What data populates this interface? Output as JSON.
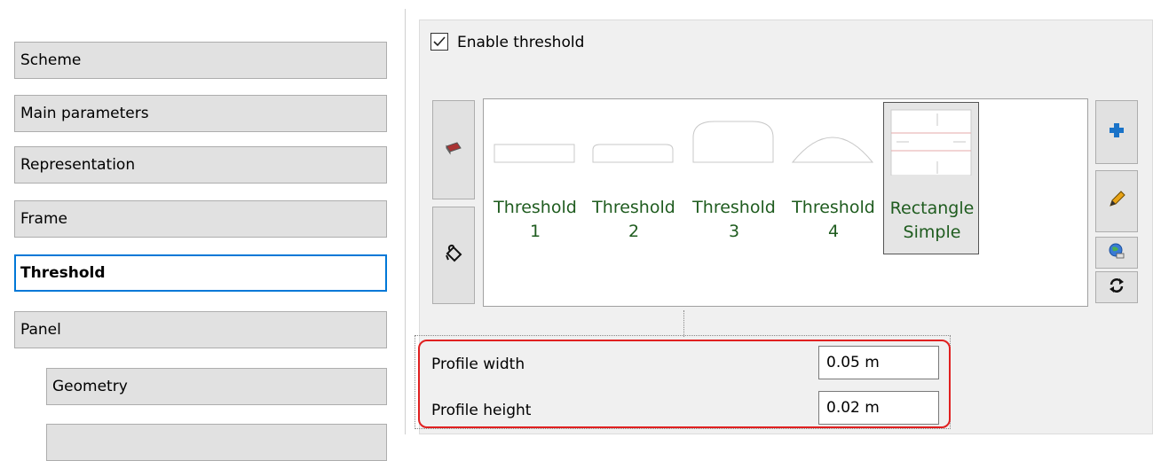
{
  "nav": {
    "items": [
      {
        "label": "Scheme"
      },
      {
        "label": "Main parameters"
      },
      {
        "label": "Representation"
      },
      {
        "label": "Frame"
      },
      {
        "label": "Threshold",
        "active": true
      },
      {
        "label": "Panel"
      },
      {
        "label": "Geometry"
      },
      {
        "label": ""
      }
    ]
  },
  "threshold": {
    "enable_label": "Enable threshold",
    "enabled": true
  },
  "gallery": {
    "items": [
      {
        "label": "Threshold 1",
        "icon": "flat-rectangle-threshold"
      },
      {
        "label": "Threshold 2",
        "icon": "rounded-threshold"
      },
      {
        "label": "Threshold 3",
        "icon": "high-rounded-threshold"
      },
      {
        "label": "Threshold 4",
        "icon": "arc-threshold"
      },
      {
        "label": "Rectangle Simple",
        "icon": "rectangle-simple-threshold",
        "selected": true
      }
    ]
  },
  "left_tools": [
    {
      "icon": "eraser-icon"
    },
    {
      "icon": "paint-bucket-icon"
    }
  ],
  "right_tools": [
    {
      "icon": "add-icon",
      "color": "#1a73c8"
    },
    {
      "icon": "pencil-icon",
      "color": "#e8a317"
    },
    {
      "icon": "globe-icon"
    },
    {
      "icon": "refresh-icon"
    }
  ],
  "profile": {
    "width_label": "Profile width",
    "width_value": "0.05 m",
    "height_label": "Profile height",
    "height_value": "0.02 m"
  },
  "colors": {
    "accent": "#0078d7",
    "highlight": "#e02020",
    "label_green": "#1f5c1f"
  }
}
